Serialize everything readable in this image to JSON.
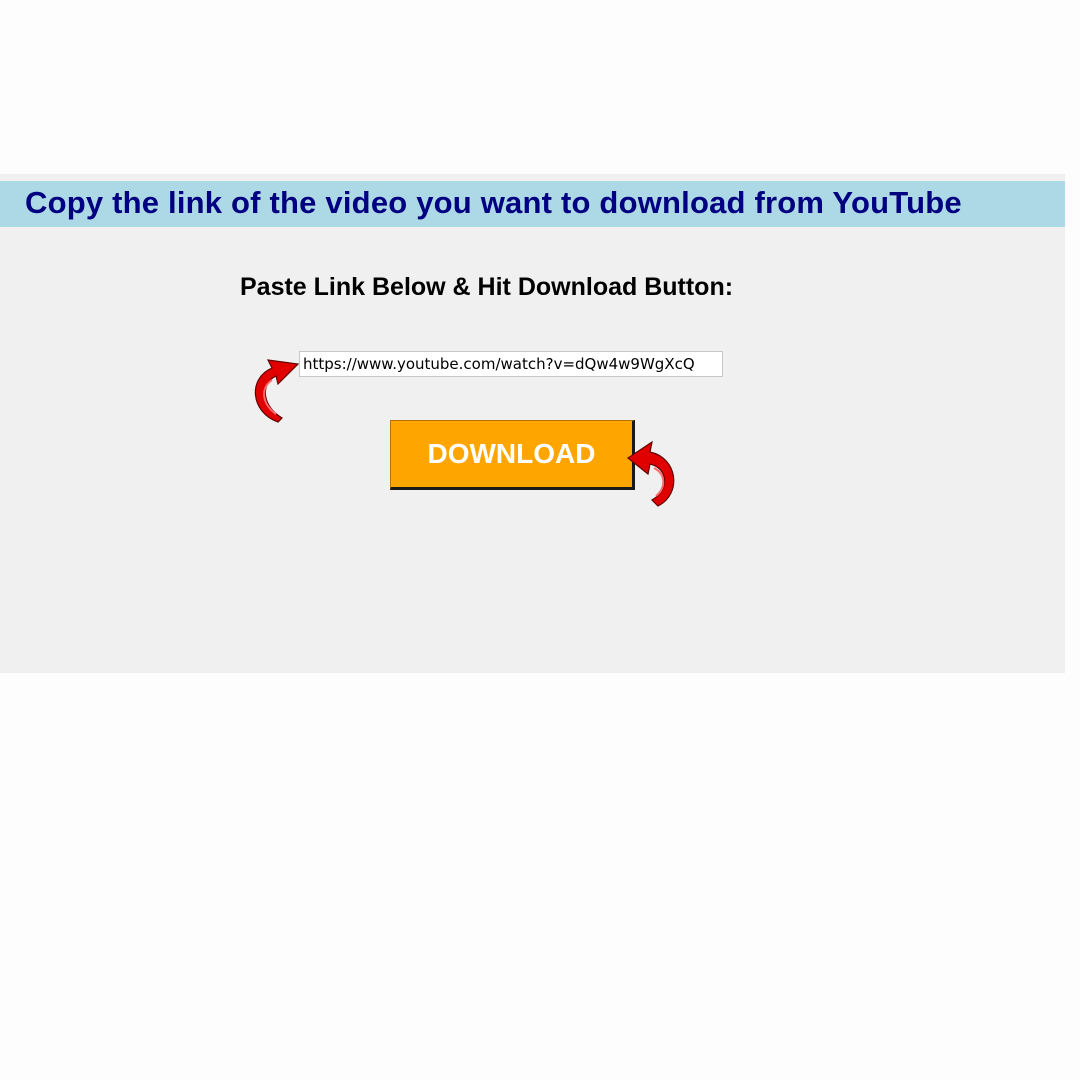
{
  "banner": {
    "text": "Copy the link of the video you want to download from YouTube"
  },
  "form": {
    "instruction": "Paste Link Below & Hit Download Button:",
    "url_value": "https://www.youtube.com/watch?v=dQw4w9WgXcQ",
    "download_label": "DOWNLOAD"
  },
  "icons": {
    "left_arrow": "curved-red-arrow-icon",
    "right_arrow": "curved-red-arrow-icon"
  },
  "colors": {
    "banner_bg": "#add8e6",
    "banner_text": "#000080",
    "button_bg": "#ffa500",
    "arrow": "#e00000"
  }
}
